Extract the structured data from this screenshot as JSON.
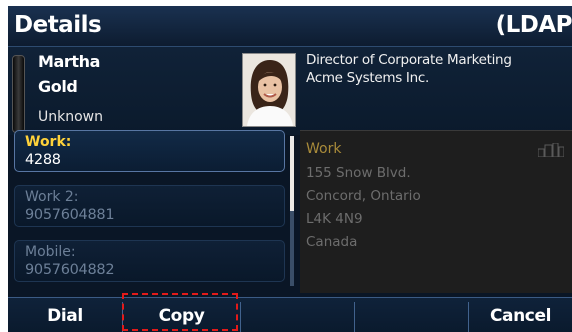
{
  "header": {
    "title": "Details",
    "source": "(LDAP)"
  },
  "contact": {
    "first_name": "Martha",
    "last_name": "Gold",
    "presence": "Unknown",
    "job_title": "Director of Corporate Marketing",
    "company": "Acme Systems Inc."
  },
  "phones": [
    {
      "label": "Work:",
      "number": "4288",
      "selected": true
    },
    {
      "label": "Work 2:",
      "number": "9057604881",
      "selected": false
    },
    {
      "label": "Mobile:",
      "number": "9057604882",
      "selected": false
    }
  ],
  "address": {
    "type": "Work",
    "street": "155 Snow Blvd.",
    "city": "Concord, Ontario",
    "postal": "L4K 4N9",
    "country": "Canada",
    "icon": "building-icon"
  },
  "softkeys": {
    "dial": "Dial",
    "copy": "Copy",
    "cancel": "Cancel"
  },
  "colors": {
    "selected_label": "#ffd23a",
    "address_title": "#a98b3a",
    "highlight": "#e21a1a",
    "background": "#0a1626"
  }
}
